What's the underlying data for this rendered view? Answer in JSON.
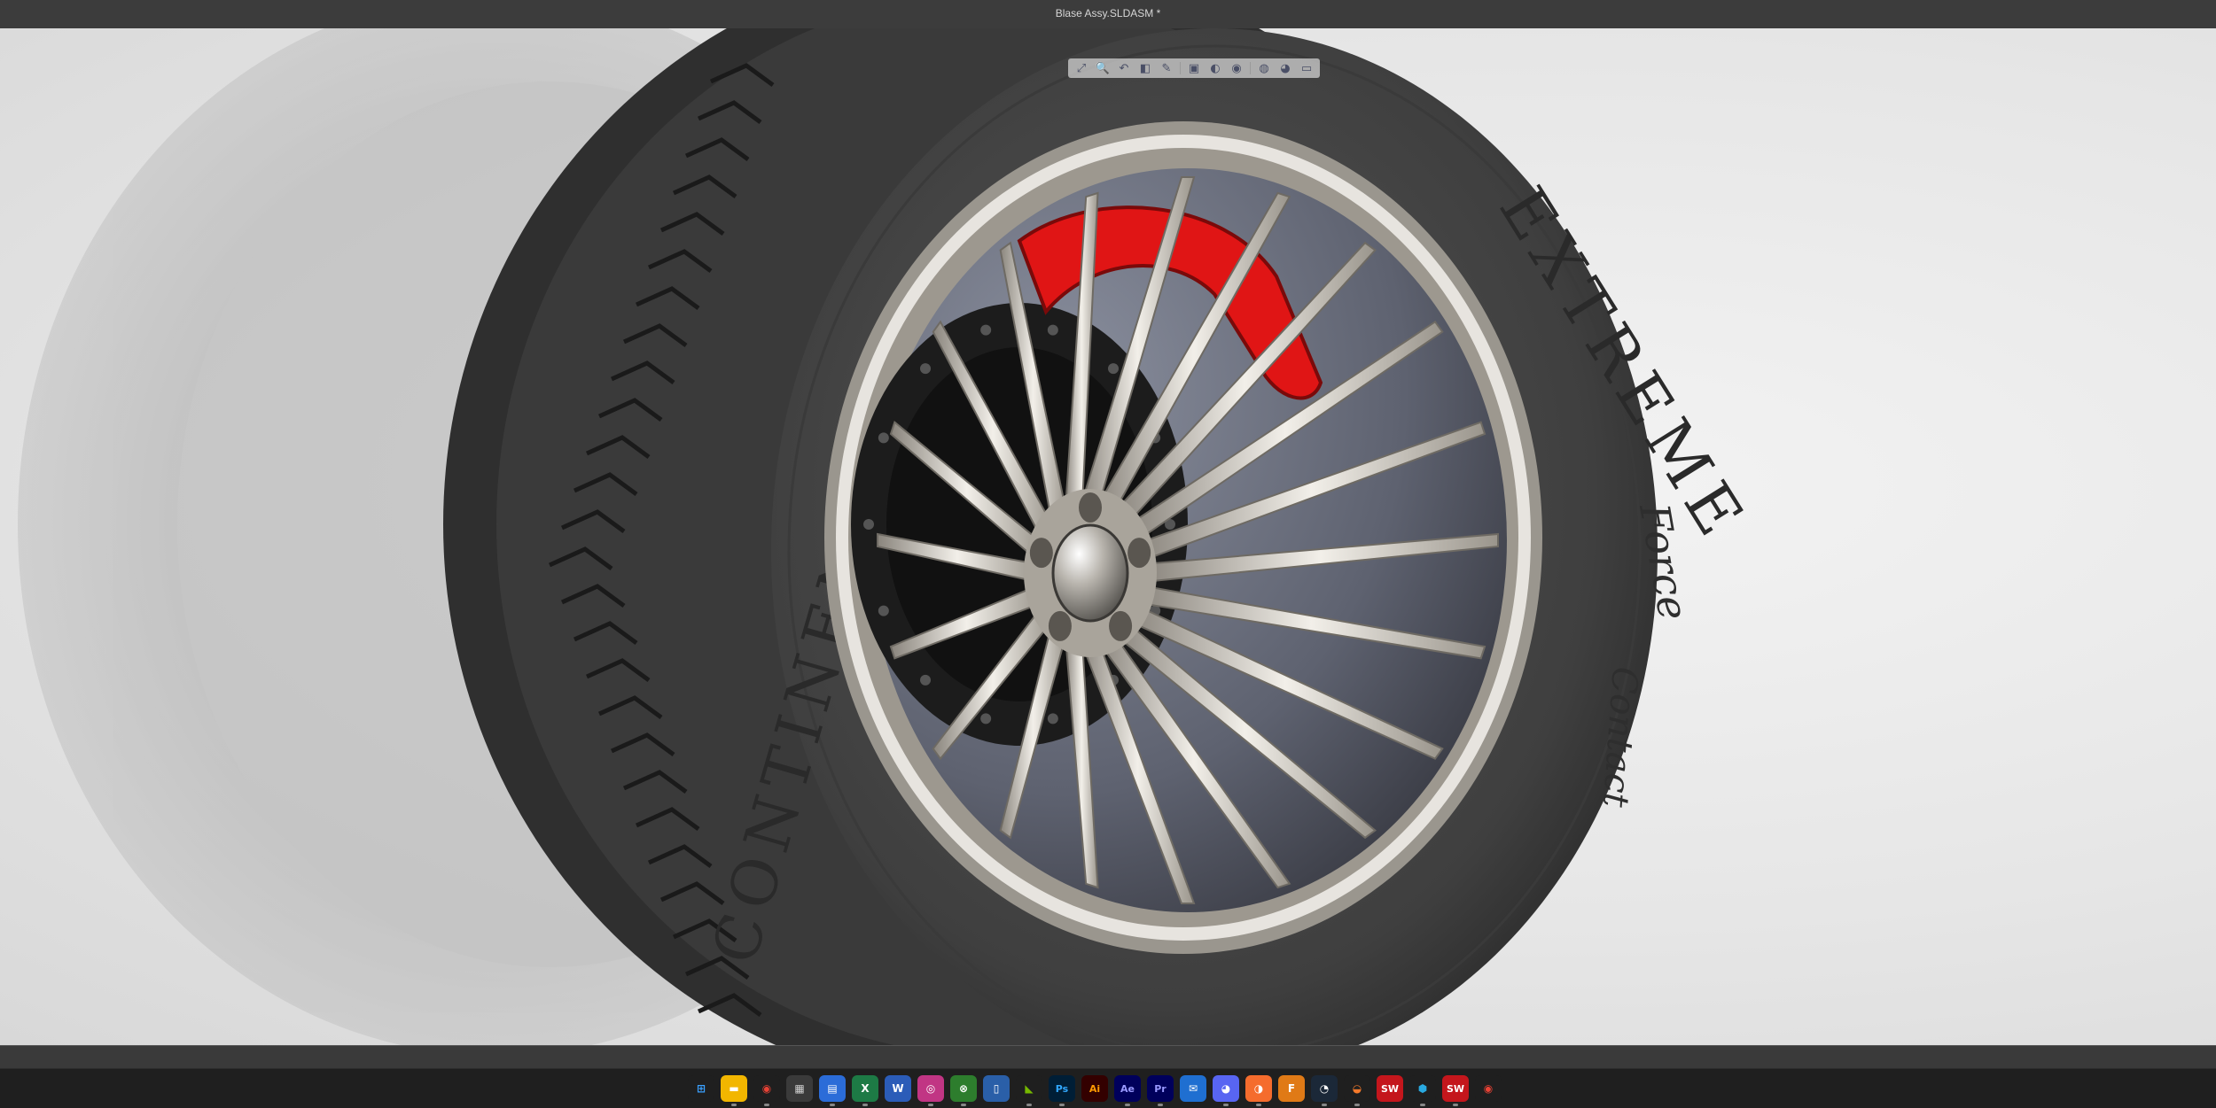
{
  "window": {
    "title": "Blase Assy.SLDASM *"
  },
  "tire": {
    "brand": "CONTINENTAL",
    "model": "EXTREME",
    "subline": "Force",
    "subline2": "Contact"
  },
  "colors": {
    "viewport_bg": "#e6e6e6",
    "tire": "#4a4a4a",
    "rim": "#b8b2aa",
    "caliper": "#e01515",
    "rotor": "#1c1c1c"
  },
  "heads_up_toolbar": {
    "items": [
      {
        "name": "zoom-to-fit-icon",
        "glyph": "⤢"
      },
      {
        "name": "zoom-to-area-icon",
        "glyph": "🔍"
      },
      {
        "name": "previous-view-icon",
        "glyph": "↶"
      },
      {
        "name": "section-view-icon",
        "glyph": "◧"
      },
      {
        "name": "dynamic-annotation-icon",
        "glyph": "✎"
      },
      {
        "name": "view-orientation-icon",
        "glyph": "▣"
      },
      {
        "name": "display-style-icon",
        "glyph": "◐"
      },
      {
        "name": "hide-show-items-icon",
        "glyph": "◉"
      },
      {
        "name": "edit-appearance-icon",
        "glyph": "◍"
      },
      {
        "name": "apply-scene-icon",
        "glyph": "◕"
      },
      {
        "name": "view-settings-icon",
        "glyph": "▭"
      }
    ]
  },
  "taskbar": {
    "icons": [
      {
        "name": "start-icon",
        "glyph": "⊞",
        "bg": "#1f1f1f",
        "fg": "#3aa0ff"
      },
      {
        "name": "file-explorer-icon",
        "glyph": "▬",
        "bg": "#f2b600",
        "fg": "#ffffff"
      },
      {
        "name": "chrome-icon",
        "glyph": "◉",
        "bg": "#1f1f1f",
        "fg": "#e94235"
      },
      {
        "name": "calculator-icon",
        "glyph": "▦",
        "bg": "#3a3a3a",
        "fg": "#cfcfcf"
      },
      {
        "name": "store-icon",
        "glyph": "▤",
        "bg": "#2b6cd8",
        "fg": "#ffffff"
      },
      {
        "name": "excel-icon",
        "glyph": "X",
        "bg": "#1d7a45",
        "fg": "#ffffff"
      },
      {
        "name": "word-icon",
        "glyph": "W",
        "bg": "#2b5cb8",
        "fg": "#ffffff"
      },
      {
        "name": "instagram-icon",
        "glyph": "◎",
        "bg": "#c13584",
        "fg": "#ffffff"
      },
      {
        "name": "xbox-icon",
        "glyph": "⊗",
        "bg": "#2d7d2d",
        "fg": "#ffffff"
      },
      {
        "name": "phone-link-icon",
        "glyph": "▯",
        "bg": "#2a5fa8",
        "fg": "#ffffff"
      },
      {
        "name": "nvidia-icon",
        "glyph": "◣",
        "bg": "#1f1f1f",
        "fg": "#76b900"
      },
      {
        "name": "photoshop-icon",
        "glyph": "Ps",
        "bg": "#001e36",
        "fg": "#31a8ff"
      },
      {
        "name": "illustrator-icon",
        "glyph": "Ai",
        "bg": "#330000",
        "fg": "#ff9a00"
      },
      {
        "name": "after-effects-icon",
        "glyph": "Ae",
        "bg": "#00005b",
        "fg": "#9999ff"
      },
      {
        "name": "premiere-icon",
        "glyph": "Pr",
        "bg": "#00005b",
        "fg": "#9999ff"
      },
      {
        "name": "mail-icon",
        "glyph": "✉",
        "bg": "#1f6fd1",
        "fg": "#ffffff"
      },
      {
        "name": "discord-icon",
        "glyph": "◕",
        "bg": "#5865f2",
        "fg": "#ffffff"
      },
      {
        "name": "origin-icon",
        "glyph": "◑",
        "bg": "#f56c2d",
        "fg": "#ffffff"
      },
      {
        "name": "fusion-icon",
        "glyph": "F",
        "bg": "#e07a16",
        "fg": "#ffffff"
      },
      {
        "name": "steam-icon",
        "glyph": "◔",
        "bg": "#1b2838",
        "fg": "#ffffff"
      },
      {
        "name": "blender-icon",
        "glyph": "◒",
        "bg": "#1f1f1f",
        "fg": "#f5792a"
      },
      {
        "name": "solidworks-2026-icon",
        "glyph": "SW",
        "bg": "#c4161c",
        "fg": "#ffffff"
      },
      {
        "name": "3d-box-icon",
        "glyph": "⬢",
        "bg": "#1f1f1f",
        "fg": "#29a9e0"
      },
      {
        "name": "solidworks-2026-alt-icon",
        "glyph": "SW",
        "bg": "#c4161c",
        "fg": "#ffffff"
      },
      {
        "name": "chrome-alt-icon",
        "glyph": "◉",
        "bg": "#1f1f1f",
        "fg": "#e94235"
      }
    ]
  }
}
